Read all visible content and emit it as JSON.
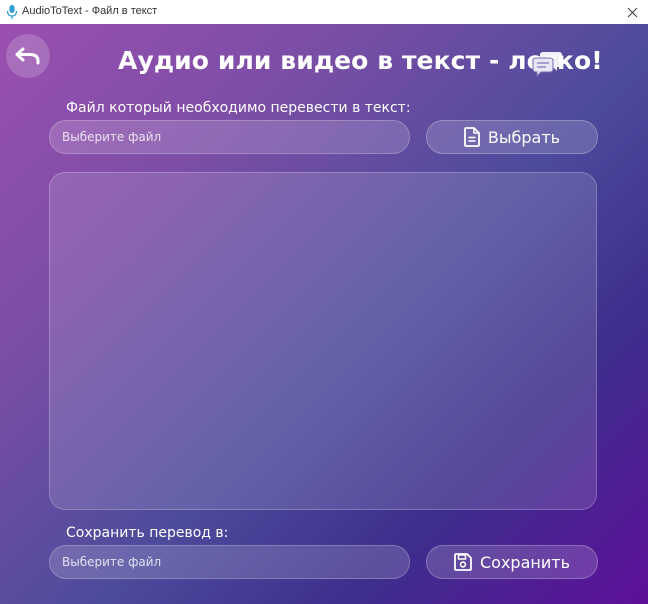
{
  "window": {
    "title": "AudioToText - Файл в текст"
  },
  "header": {
    "title": "Аудио или видео в текст - легко!",
    "back_icon": "undo-icon",
    "chat_icon": "chat-bubbles-icon"
  },
  "input_section": {
    "label": "Файл который необходимо перевести в текст:",
    "placeholder": "Выберите файл",
    "value": "",
    "button_label": "Выбрать",
    "button_icon": "document-icon"
  },
  "transcript": {
    "text": ""
  },
  "output_section": {
    "label": "Сохранить перевод в:",
    "placeholder": "Выберите файл",
    "value": "",
    "button_label": "Сохранить",
    "button_icon": "floppy-disk-icon"
  },
  "colors": {
    "gradient_start": "#9b4fb0",
    "gradient_mid": "#4d4b9c",
    "gradient_end": "#5e0f9a",
    "text": "#ffffff"
  }
}
